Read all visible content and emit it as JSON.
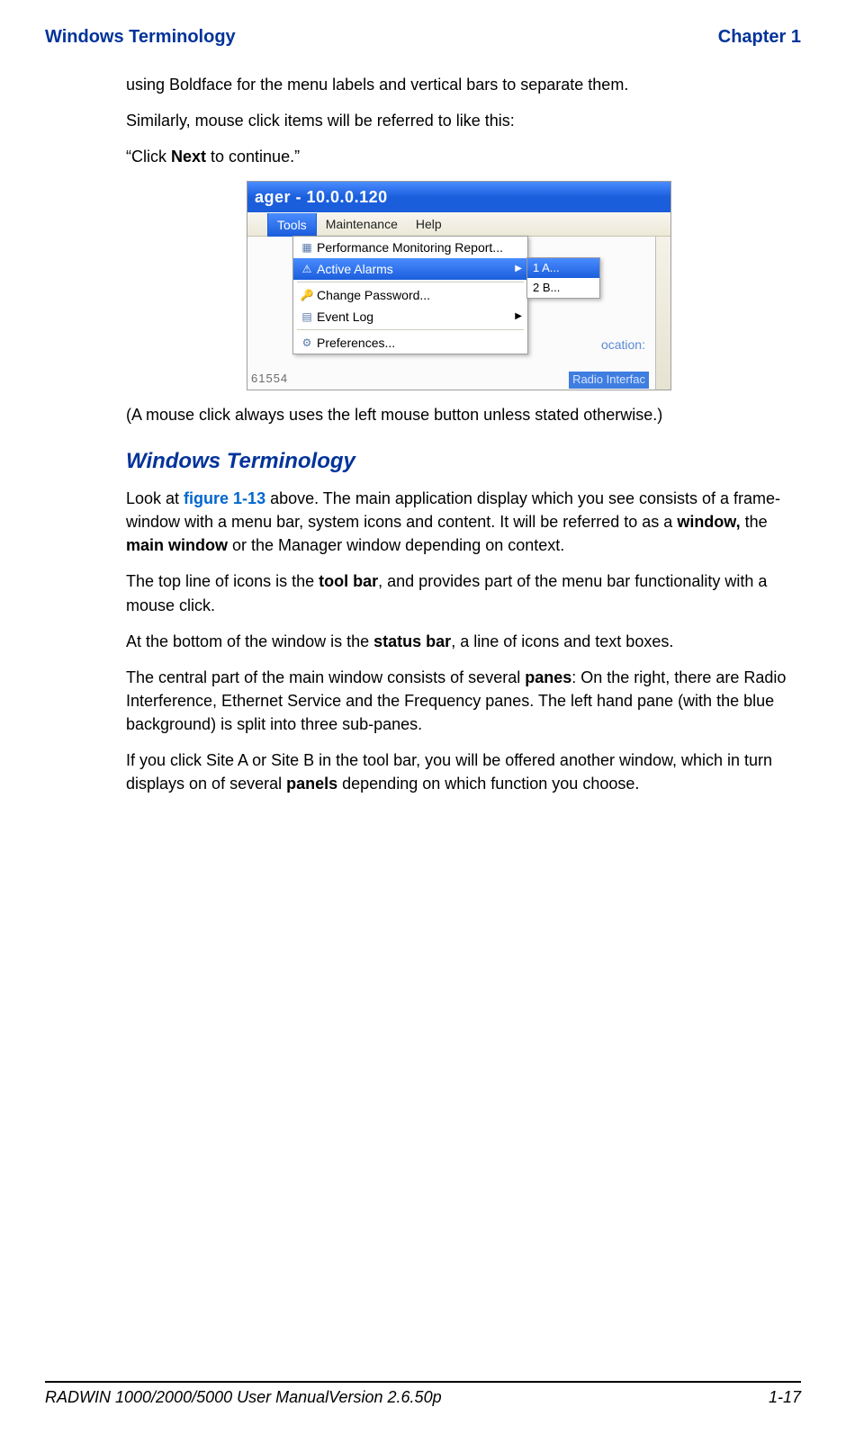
{
  "header": {
    "left": "Windows Terminology",
    "right": "Chapter 1"
  },
  "intro": {
    "p1": "using Boldface for the menu labels and vertical bars to separate them.",
    "p2": "Similarly, mouse click items will be referred to like this:",
    "p3_pre": "“Click ",
    "p3_bold": "Next",
    "p3_post": " to continue.”"
  },
  "screenshot": {
    "title": "ager - 10.0.0.120",
    "menu": {
      "tools": "Tools",
      "maintenance": "Maintenance",
      "help": "Help"
    },
    "dropdown": {
      "perf": "Performance Monitoring Report...",
      "alarms": "Active Alarms",
      "changepw": "Change Password...",
      "eventlog": "Event Log",
      "prefs": "Preferences..."
    },
    "submenu": {
      "a": "1 A...",
      "b": "2 B..."
    },
    "bg": {
      "location": "ocation:",
      "num": "61554",
      "radio": "Radio Interfac"
    }
  },
  "caption": "(A mouse click always uses the left mouse button unless stated otherwise.)",
  "section": {
    "title": "Windows Terminology",
    "p1_pre": "Look at ",
    "p1_link": "figure 1-13",
    "p1_mid": " above. The main application display which you see consists of a frame-window with a menu bar, system icons and content. It will be referred to as a ",
    "p1_b1": "window,",
    "p1_mid2": " the ",
    "p1_b2": "main window",
    "p1_post": " or the Manager window depending on context.",
    "p2_pre": "The top line of icons is the ",
    "p2_b": "tool bar",
    "p2_post": ", and provides part of the menu bar functionality with a mouse click.",
    "p3_pre": "At the bottom of the window is the ",
    "p3_b": "status bar",
    "p3_post": ", a line of icons and text boxes.",
    "p4_pre": "The central part of the main window consists of several ",
    "p4_b": "panes",
    "p4_post": ": On the right, there are Radio Interference, Ethernet Service and the Frequency panes. The left hand pane (with the blue background) is split into three sub-panes.",
    "p5_pre": "If you click Site A or Site B in the tool bar, you will be offered another window, which in turn displays on of several ",
    "p5_b": "panels",
    "p5_post": " depending on which function you choose."
  },
  "footer": {
    "left": "RADWIN 1000/2000/5000 User ManualVersion  2.6.50p",
    "right": "1-17"
  }
}
